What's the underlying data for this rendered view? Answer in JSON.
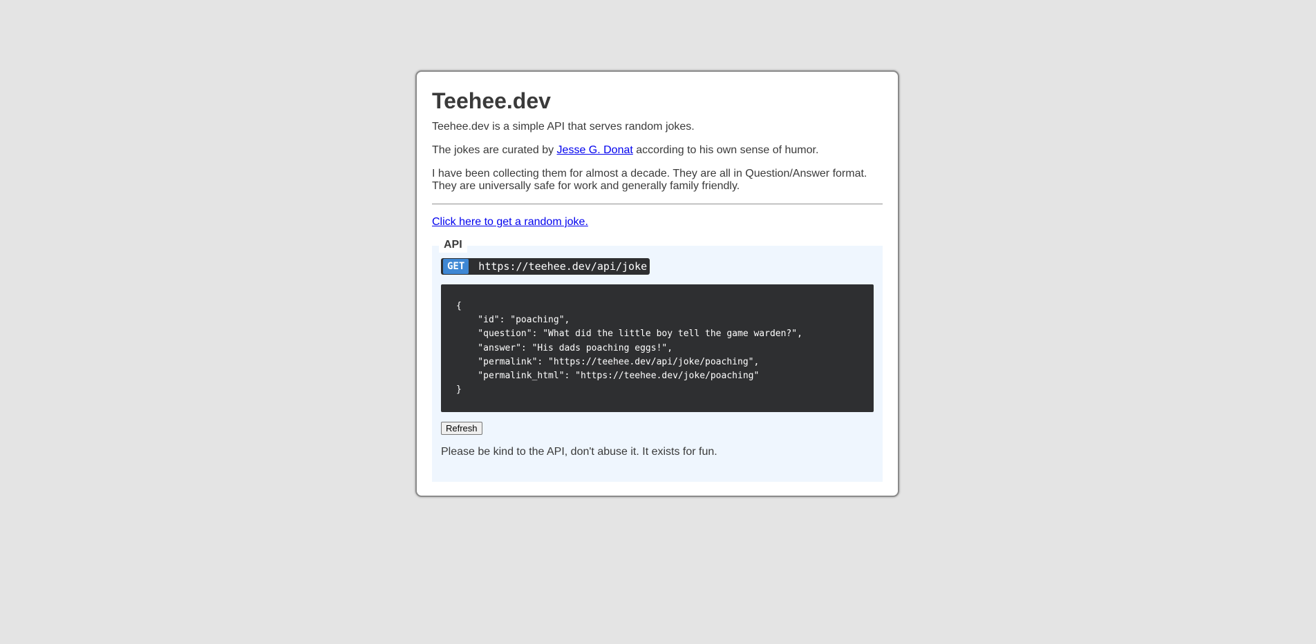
{
  "title": "Teehee.dev",
  "intro": {
    "line1": "Teehee.dev is a simple API that serves random jokes.",
    "line2_prefix": "The jokes are curated by ",
    "author_link": "Jesse G. Donat",
    "line2_suffix": " according to his own sense of humor.",
    "line3": "I have been collecting them for almost a decade. They are all in Question/Answer format. They are universally safe for work and generally family friendly."
  },
  "random_link": "Click here to get a random joke.",
  "api": {
    "legend": "API",
    "method": "GET",
    "url": "https://teehee.dev/api/joke",
    "response": "{\n    \"id\": \"poaching\",\n    \"question\": \"What did the little boy tell the game warden?\",\n    \"answer\": \"His dads poaching eggs!\",\n    \"permalink\": \"https://teehee.dev/api/joke/poaching\",\n    \"permalink_html\": \"https://teehee.dev/joke/poaching\"\n}",
    "refresh_label": "Refresh",
    "note": "Please be kind to the API, don't abuse it. It exists for fun."
  },
  "colors": {
    "background": "#e4e4e4",
    "card": "#ffffff",
    "api_panel": "#eff6fe",
    "code_bg": "#2e2f31",
    "method_badge": "#3e87d4",
    "link": "#0000ee"
  }
}
